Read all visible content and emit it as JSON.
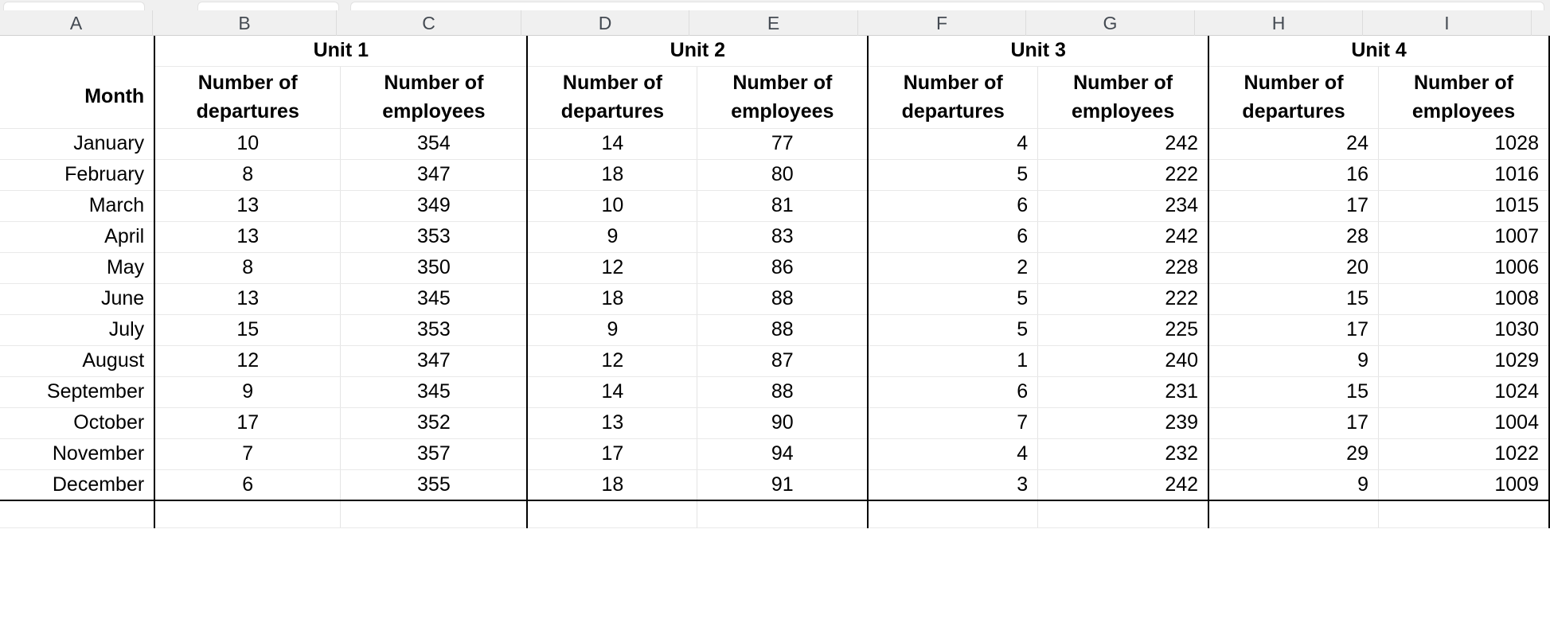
{
  "app": {
    "type": "spreadsheet",
    "column_letters": [
      "A",
      "B",
      "C",
      "D",
      "E",
      "F",
      "G",
      "H",
      "I"
    ]
  },
  "table": {
    "corner_label": "Month",
    "unit_groups": [
      {
        "title": "Unit 1",
        "columns": [
          "B",
          "C"
        ]
      },
      {
        "title": "Unit 2",
        "columns": [
          "D",
          "E"
        ]
      },
      {
        "title": "Unit 3",
        "columns": [
          "F",
          "G"
        ]
      },
      {
        "title": "Unit 4",
        "columns": [
          "H",
          "I"
        ]
      }
    ],
    "sub_headers": {
      "departures": "Number of departures",
      "employees": "Number of employees",
      "departures_line1": "Number of",
      "departures_line2": "departures",
      "employees_line1": "Number of",
      "employees_line2": "employees"
    },
    "rows": [
      {
        "month": "January",
        "u1_dep": "10",
        "u1_emp": "354",
        "u2_dep": "14",
        "u2_emp": "77",
        "u3_dep": "4",
        "u3_emp": "242",
        "u4_dep": "24",
        "u4_emp": "1028"
      },
      {
        "month": "February",
        "u1_dep": "8",
        "u1_emp": "347",
        "u2_dep": "18",
        "u2_emp": "80",
        "u3_dep": "5",
        "u3_emp": "222",
        "u4_dep": "16",
        "u4_emp": "1016"
      },
      {
        "month": "March",
        "u1_dep": "13",
        "u1_emp": "349",
        "u2_dep": "10",
        "u2_emp": "81",
        "u3_dep": "6",
        "u3_emp": "234",
        "u4_dep": "17",
        "u4_emp": "1015"
      },
      {
        "month": "April",
        "u1_dep": "13",
        "u1_emp": "353",
        "u2_dep": "9",
        "u2_emp": "83",
        "u3_dep": "6",
        "u3_emp": "242",
        "u4_dep": "28",
        "u4_emp": "1007"
      },
      {
        "month": "May",
        "u1_dep": "8",
        "u1_emp": "350",
        "u2_dep": "12",
        "u2_emp": "86",
        "u3_dep": "2",
        "u3_emp": "228",
        "u4_dep": "20",
        "u4_emp": "1006"
      },
      {
        "month": "June",
        "u1_dep": "13",
        "u1_emp": "345",
        "u2_dep": "18",
        "u2_emp": "88",
        "u3_dep": "5",
        "u3_emp": "222",
        "u4_dep": "15",
        "u4_emp": "1008"
      },
      {
        "month": "July",
        "u1_dep": "15",
        "u1_emp": "353",
        "u2_dep": "9",
        "u2_emp": "88",
        "u3_dep": "5",
        "u3_emp": "225",
        "u4_dep": "17",
        "u4_emp": "1030"
      },
      {
        "month": "August",
        "u1_dep": "12",
        "u1_emp": "347",
        "u2_dep": "12",
        "u2_emp": "87",
        "u3_dep": "1",
        "u3_emp": "240",
        "u4_dep": "9",
        "u4_emp": "1029"
      },
      {
        "month": "September",
        "u1_dep": "9",
        "u1_emp": "345",
        "u2_dep": "14",
        "u2_emp": "88",
        "u3_dep": "6",
        "u3_emp": "231",
        "u4_dep": "15",
        "u4_emp": "1024"
      },
      {
        "month": "October",
        "u1_dep": "17",
        "u1_emp": "352",
        "u2_dep": "13",
        "u2_emp": "90",
        "u3_dep": "7",
        "u3_emp": "239",
        "u4_dep": "17",
        "u4_emp": "1004"
      },
      {
        "month": "November",
        "u1_dep": "7",
        "u1_emp": "357",
        "u2_dep": "17",
        "u2_emp": "94",
        "u3_dep": "4",
        "u3_emp": "232",
        "u4_dep": "29",
        "u4_emp": "1022"
      },
      {
        "month": "December",
        "u1_dep": "6",
        "u1_emp": "355",
        "u2_dep": "18",
        "u2_emp": "91",
        "u3_dep": "3",
        "u3_emp": "242",
        "u4_dep": "9",
        "u4_emp": "1009"
      }
    ]
  },
  "style": {
    "header_bg": "#f0f0f0",
    "grid_line": "#e4e4e4",
    "heavy_border": "#000000",
    "text": "#000000",
    "col_letter_text": "#444a52"
  }
}
